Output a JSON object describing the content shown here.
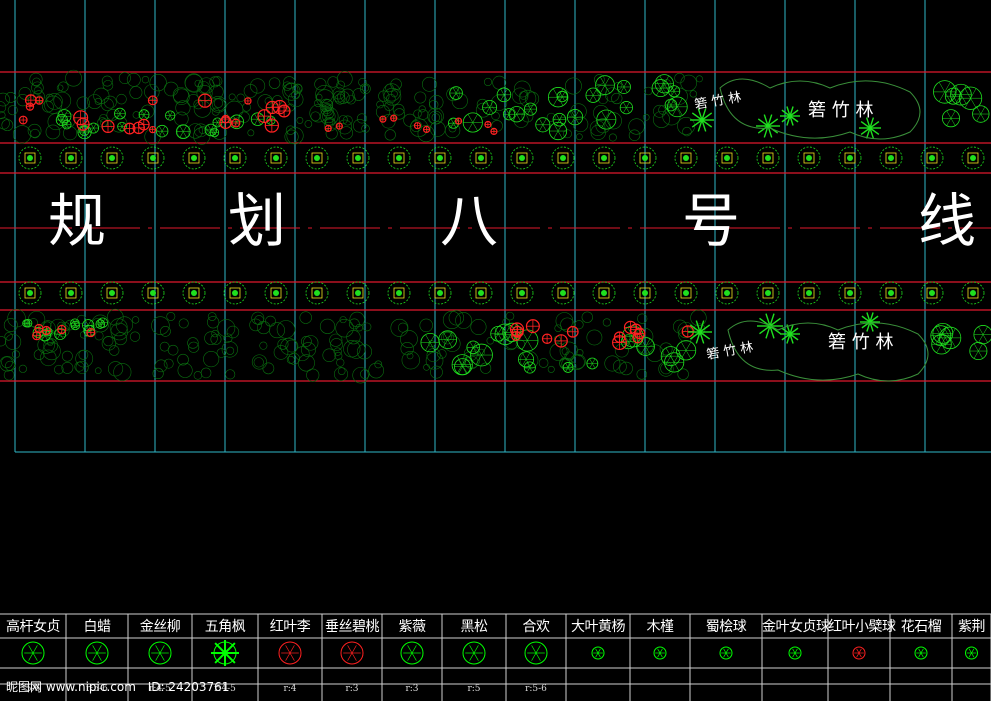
{
  "title": {
    "chars": [
      "规",
      "划",
      "八",
      "号",
      "线"
    ]
  },
  "bamboo_labels": {
    "upper_small": "箬 竹 林",
    "upper_large": "箬 竹 林",
    "lower_small": "箬 竹 林",
    "lower_large": "箬 竹 林"
  },
  "legend": [
    {
      "name": "高杆女贞",
      "radius": "5-6",
      "icon": "privet-icon",
      "color": "#00ff00"
    },
    {
      "name": "白蜡",
      "radius": "r:5-6",
      "icon": "ash-tree-icon",
      "color": "#00ff00"
    },
    {
      "name": "金丝柳",
      "radius": "r:4-5",
      "icon": "golden-willow-icon",
      "color": "#00ff00"
    },
    {
      "name": "五角枫",
      "radius": "r:4-5",
      "icon": "maple-icon",
      "color": "#00ff00"
    },
    {
      "name": "红叶李",
      "radius": "r:4",
      "icon": "red-plum-icon",
      "color": "#ff2020"
    },
    {
      "name": "垂丝碧桃",
      "radius": "r:3",
      "icon": "peach-icon",
      "color": "#ff2020"
    },
    {
      "name": "紫薇",
      "radius": "r:3",
      "icon": "crape-myrtle-icon",
      "color": "#00ff00"
    },
    {
      "name": "黑松",
      "radius": "r:5",
      "icon": "black-pine-icon",
      "color": "#00ff00"
    },
    {
      "name": "合欢",
      "radius": "r:5-6",
      "icon": "silk-tree-icon",
      "color": "#00ff00"
    },
    {
      "name": "大叶黄杨",
      "radius": "",
      "icon": "boxwood-icon",
      "color": "#00ff00"
    },
    {
      "name": "木槿",
      "radius": "",
      "icon": "hibiscus-icon",
      "color": "#00ff00"
    },
    {
      "name": "蜀桧球",
      "radius": "",
      "icon": "juniper-ball-icon",
      "color": "#00ff00"
    },
    {
      "name": "金叶女贞球",
      "radius": "",
      "icon": "golden-privet-ball-icon",
      "color": "#00ff00"
    },
    {
      "name": "红叶小檗球",
      "radius": "",
      "icon": "barberry-ball-icon",
      "color": "#ff2020"
    },
    {
      "name": "花石榴",
      "radius": "",
      "icon": "pomegranate-icon",
      "color": "#00ff00"
    },
    {
      "name": "紫荆",
      "radius": "",
      "icon": "redbud-icon",
      "color": "#00ff00"
    }
  ],
  "watermark": "昵图网 www.nipic.com",
  "watermark_id": "ID: 24203761",
  "colors": {
    "grid": "#2fb7c7",
    "road_line": "#e0182c",
    "plant_green": "#1fe01f",
    "plant_dark": "#0a6f10",
    "flower_red": "#ff2222",
    "background": "#000000"
  }
}
